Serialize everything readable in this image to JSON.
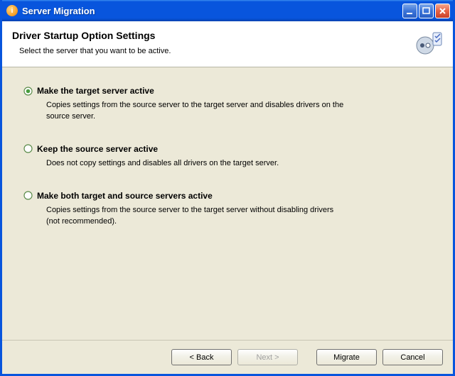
{
  "window": {
    "title": "Server Migration"
  },
  "header": {
    "title": "Driver Startup Option Settings",
    "subtitle": "Select the server that you want to be active."
  },
  "options": [
    {
      "label": "Make the target server active",
      "description": "Copies settings from the source server to the target server and disables drivers on the source server.",
      "selected": true
    },
    {
      "label": "Keep the source server active",
      "description": "Does not copy settings and disables all drivers on the target server.",
      "selected": false
    },
    {
      "label": "Make both target and source servers active",
      "description": "Copies settings from the source server to the target server without disabling drivers (not recommended).",
      "selected": false
    }
  ],
  "buttons": {
    "back": "< Back",
    "next": "Next >",
    "migrate": "Migrate",
    "cancel": "Cancel"
  }
}
